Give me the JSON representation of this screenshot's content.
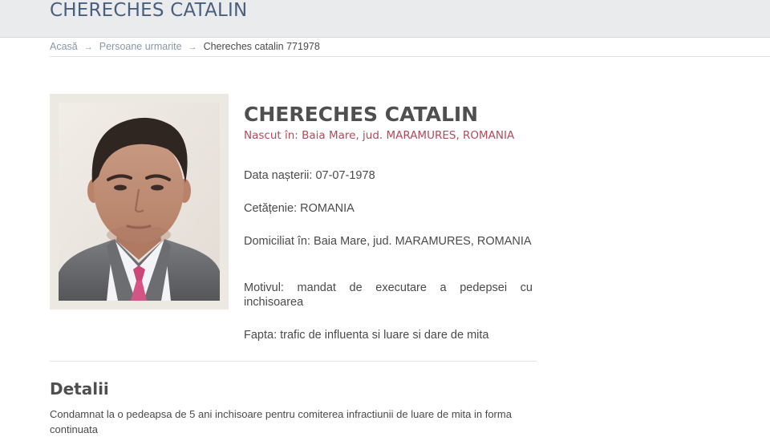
{
  "header": {
    "title": "CHERECHES CATALIN"
  },
  "breadcrumb": {
    "home": "Acasă",
    "section": "Persoane urmarite",
    "current": "Chereches catalin 771978",
    "separator": "→"
  },
  "profile": {
    "name": "CHERECHES CATALIN",
    "birthplace": "Nascut în: Baia Mare, jud. MARAMURES, ROMANIA",
    "birth_date": "Data nașterii: 07-07-1978",
    "citizenship": "Cetățenie: ROMANIA",
    "domicile": "Domiciliat în: Baia Mare, jud. MARAMURES, ROMANIA",
    "reason": "Motivul: mandat de executare a pedepsei cu inchisoarea",
    "offense": "Fapta: trafic de influenta si luare si dare de mita"
  },
  "details": {
    "heading": "Detalii",
    "text": "Condamnat la o pedeapsa de 5 ani inchisoare pentru comiterea infractiunii de luare de mita in forma continuata"
  },
  "colors": {
    "header_bg": "#e9ebed",
    "header_title": "#4a5f7f",
    "birthplace_accent": "#b24a5c",
    "text": "#4a4a4a"
  }
}
